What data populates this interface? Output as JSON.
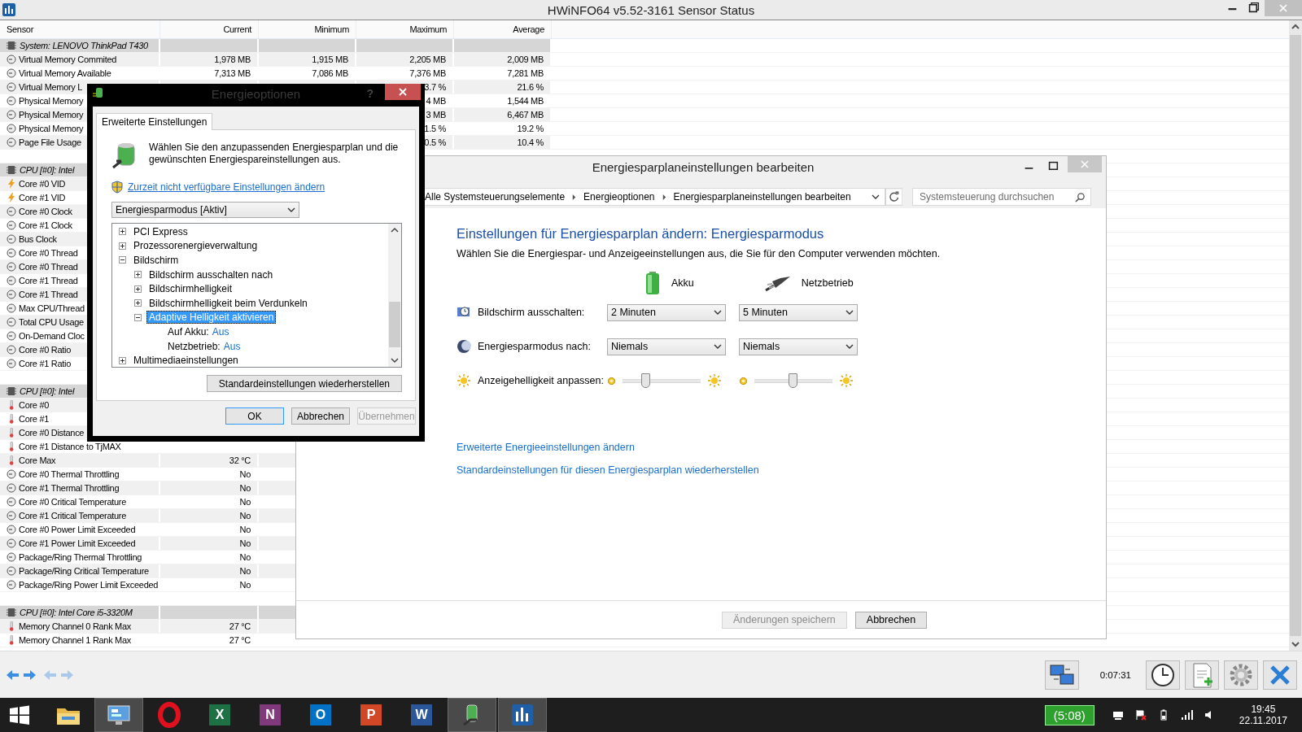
{
  "main_window": {
    "title": "HWiNFO64 v5.52-3161 Sensor Status"
  },
  "sensor_table": {
    "columns": [
      "Sensor",
      "Current",
      "Minimum",
      "Maximum",
      "Average"
    ],
    "groups": [
      {
        "title": "System: LENOVO ThinkPad T430",
        "rows": [
          {
            "kind": "gauge",
            "name": "Virtual Memory Commited",
            "current": "1,978 MB",
            "minimum": "1,915 MB",
            "maximum": "2,205 MB",
            "average": "2,009 MB"
          },
          {
            "kind": "gauge",
            "name": "Virtual Memory Available",
            "current": "7,313 MB",
            "minimum": "7,086 MB",
            "maximum": "7,376 MB",
            "average": "7,281 MB"
          },
          {
            "kind": "gauge",
            "name": "Virtual Memory L",
            "maximum": "3.7 %",
            "average": "21.6 %"
          },
          {
            "kind": "gauge",
            "name": "Physical Memory",
            "maximum": "4 MB",
            "average": "1,544 MB"
          },
          {
            "kind": "gauge",
            "name": "Physical Memory",
            "maximum": "3 MB",
            "average": "6,467 MB"
          },
          {
            "kind": "gauge",
            "name": "Physical Memory",
            "maximum": "1.5 %",
            "average": "19.2 %"
          },
          {
            "kind": "gauge",
            "name": "Page File Usage",
            "maximum": "0.5 %",
            "average": "10.4 %"
          }
        ]
      },
      {
        "title": "CPU [#0]: Intel",
        "rows": [
          {
            "kind": "voltage",
            "name": "Core #0 VID"
          },
          {
            "kind": "voltage",
            "name": "Core #1 VID"
          },
          {
            "kind": "gauge",
            "name": "Core #0 Clock"
          },
          {
            "kind": "gauge",
            "name": "Core #1 Clock"
          },
          {
            "kind": "gauge",
            "name": "Bus Clock"
          },
          {
            "kind": "gauge",
            "name": "Core #0 Thread"
          },
          {
            "kind": "gauge",
            "name": "Core #0 Thread"
          },
          {
            "kind": "gauge",
            "name": "Core #1 Thread"
          },
          {
            "kind": "gauge",
            "name": "Core #1 Thread"
          },
          {
            "kind": "gauge",
            "name": "Max CPU/Thread"
          },
          {
            "kind": "gauge",
            "name": "Total CPU Usage"
          },
          {
            "kind": "gauge",
            "name": "On-Demand Cloc"
          },
          {
            "kind": "gauge",
            "name": "Core #0 Ratio"
          },
          {
            "kind": "gauge",
            "name": "Core #1 Ratio"
          }
        ]
      },
      {
        "title": "CPU [#0]: Intel",
        "rows": [
          {
            "kind": "temperature",
            "name": "Core #0"
          },
          {
            "kind": "temperature",
            "name": "Core #1"
          },
          {
            "kind": "temperature",
            "name": "Core #0 Distance"
          },
          {
            "kind": "temperature",
            "name": "Core #1 Distance to TjMAX"
          },
          {
            "kind": "temperature",
            "name": "Core Max",
            "current": "32 °C"
          },
          {
            "kind": "gauge",
            "name": "Core #0 Thermal Throttling",
            "current": "No"
          },
          {
            "kind": "gauge",
            "name": "Core #1 Thermal Throttling",
            "current": "No"
          },
          {
            "kind": "gauge",
            "name": "Core #0 Critical Temperature",
            "current": "No"
          },
          {
            "kind": "gauge",
            "name": "Core #1 Critical Temperature",
            "current": "No"
          },
          {
            "kind": "gauge",
            "name": "Core #0 Power Limit Exceeded",
            "current": "No"
          },
          {
            "kind": "gauge",
            "name": "Core #1 Power Limit Exceeded",
            "current": "No"
          },
          {
            "kind": "gauge",
            "name": "Package/Ring Thermal Throttling",
            "current": "No"
          },
          {
            "kind": "gauge",
            "name": "Package/Ring Critical Temperature",
            "current": "No"
          },
          {
            "kind": "gauge",
            "name": "Package/Ring Power Limit Exceeded",
            "current": "No"
          }
        ]
      },
      {
        "title": "CPU [#0]: Intel Core i5-3320M",
        "rows": [
          {
            "kind": "temperature",
            "name": "Memory Channel 0 Rank Max",
            "current": "27 °C"
          },
          {
            "kind": "temperature",
            "name": "Memory Channel 1 Rank Max",
            "current": "27 °C"
          }
        ]
      }
    ]
  },
  "toolbar": {
    "timer": "0:07:31"
  },
  "power_dialog": {
    "title": "Energieoptionen",
    "help": "?",
    "tab": {
      "label": "Erweiterte Einstellungen",
      "selected": true
    },
    "intro": "Wählen Sie den anzupassenden Energiesparplan und die gewünschten Energiespareinstellungen aus.",
    "admin_link": "Zurzeit nicht verfügbare Einstellungen ändern",
    "plan_select": "Energiesparmodus [Aktiv]",
    "tree": [
      {
        "label": "PCI Express",
        "expanded": false,
        "selected": false
      },
      {
        "label": "Prozessorenergieverwaltung",
        "expanded": false,
        "selected": false
      },
      {
        "label": "Bildschirm",
        "expanded": true,
        "selected": false,
        "children": [
          {
            "label": "Bildschirm ausschalten nach",
            "expanded": false,
            "selected": false
          },
          {
            "label": "Bildschirmhelligkeit",
            "expanded": false,
            "selected": false
          },
          {
            "label": "Bildschirmhelligkeit beim Verdunkeln",
            "expanded": false,
            "selected": false
          },
          {
            "label": "Adaptive Helligkeit aktivieren",
            "expanded": true,
            "selected": true,
            "children": [
              {
                "label": "Auf Akku:",
                "value": "Aus"
              },
              {
                "label": "Netzbetrieb:",
                "value": "Aus"
              }
            ]
          }
        ]
      },
      {
        "label": "Multimediaeinstellungen",
        "expanded": false,
        "selected": false
      }
    ],
    "restore_button": "Standardeinstellungen wiederherstellen",
    "buttons": [
      {
        "label": "OK",
        "kind": "default",
        "disabled": false
      },
      {
        "label": "Abbrechen",
        "kind": "normal",
        "disabled": false
      },
      {
        "label": "Übernehmen",
        "kind": "normal",
        "disabled": true
      }
    ]
  },
  "control_window": {
    "title": "Energiesparplaneinstellungen bearbeiten",
    "breadcrumb": [
      "Alle Systemsteuerungselemente",
      "Energieoptionen",
      "Energiesparplaneinstellungen bearbeiten"
    ],
    "search": {
      "placeholder": "Systemsteuerung durchsuchen"
    },
    "heading": "Einstellungen für Energiesparplan ändern: Energiesparmodus",
    "description": "Wählen Sie die Energiespar- und Anzeigeeinstellungen aus, die Sie für den Computer verwenden möchten.",
    "power_sources": [
      {
        "kind": "battery",
        "label": "Akku"
      },
      {
        "kind": "plug",
        "label": "Netzbetrieb"
      }
    ],
    "settings": [
      {
        "kind": "select",
        "label": "Bildschirm ausschalten:",
        "columns": [
          {
            "value": "2 Minuten"
          },
          {
            "value": "5 Minuten"
          }
        ]
      },
      {
        "kind": "select",
        "label": "Energiesparmodus nach:",
        "columns": [
          {
            "value": "Niemals"
          },
          {
            "value": "Niemals"
          }
        ]
      },
      {
        "kind": "slider",
        "label": "Anzeigehelligkeit anpassen:",
        "columns": [
          {
            "level": 0.3
          },
          {
            "level": 0.5
          }
        ]
      }
    ],
    "links": [
      "Erweiterte Energieeinstellungen ändern",
      "Standardeinstellungen für diesen Energiesparplan wiederherstellen"
    ],
    "buttons": [
      {
        "label": "Änderungen speichern",
        "disabled": true
      },
      {
        "label": "Abbrechen",
        "disabled": false
      }
    ]
  },
  "taskbar": {
    "apps": [
      {
        "kind": "explorer",
        "active": false
      },
      {
        "kind": "control-panel",
        "active": true
      },
      {
        "kind": "opera",
        "active": false
      },
      {
        "kind": "office",
        "glyph": "X",
        "color": "#1e7145",
        "active": false
      },
      {
        "kind": "office",
        "glyph": "N",
        "color": "#80397b",
        "active": false
      },
      {
        "kind": "office",
        "glyph": "O",
        "color": "#0072c6",
        "active": false
      },
      {
        "kind": "office",
        "glyph": "P",
        "color": "#d24726",
        "active": false
      },
      {
        "kind": "office",
        "glyph": "W",
        "color": "#2b579a",
        "active": false
      },
      {
        "kind": "power",
        "active": true
      },
      {
        "kind": "hwinfo",
        "active": true
      }
    ],
    "battery": "(5:08)",
    "time": "19:45",
    "date": "22.11.2017"
  }
}
